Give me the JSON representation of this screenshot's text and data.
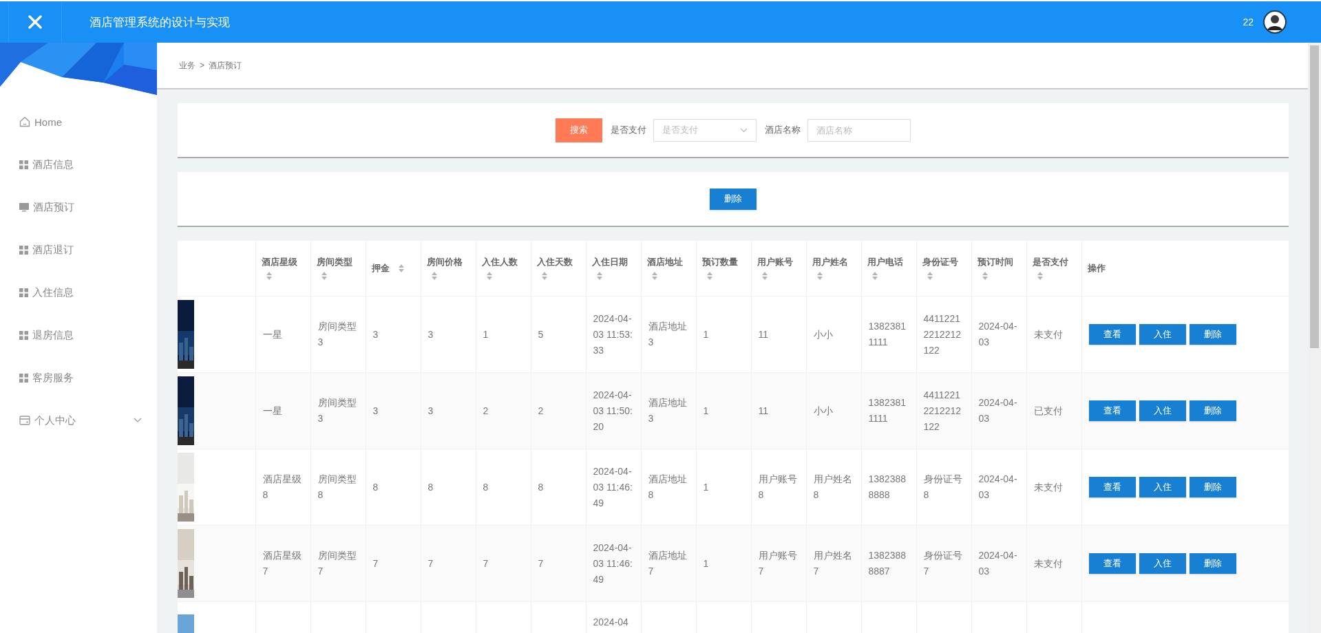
{
  "header": {
    "title": "酒店管理系统的设计与实现",
    "username": "22"
  },
  "sidebar": {
    "items": [
      {
        "label": "Home",
        "kind": "home"
      },
      {
        "label": "酒店信息",
        "kind": "grid"
      },
      {
        "label": "酒店预订",
        "kind": "monitor"
      },
      {
        "label": "酒店退订",
        "kind": "grid"
      },
      {
        "label": "入住信息",
        "kind": "grid"
      },
      {
        "label": "退房信息",
        "kind": "grid"
      },
      {
        "label": "客房服务",
        "kind": "grid"
      },
      {
        "label": "个人中心",
        "kind": "card",
        "expanded": false
      }
    ]
  },
  "breadcrumb": {
    "items": [
      "业务",
      "酒店预订"
    ],
    "separator": ">"
  },
  "search": {
    "button": "搜索",
    "fields": [
      {
        "label": "是否支付",
        "kind": "select",
        "placeholder": "是否支付"
      },
      {
        "label": "酒店名称",
        "kind": "input",
        "placeholder": "酒店名称"
      }
    ]
  },
  "toolbar": {
    "button": "删除"
  },
  "table": {
    "columns": [
      {
        "label": "酒店星级",
        "sortable": true
      },
      {
        "label": "房间类型",
        "sortable": true
      },
      {
        "label": "押金",
        "sortable": true
      },
      {
        "label": "房间价格",
        "sortable": true
      },
      {
        "label": "入住人数",
        "sortable": true
      },
      {
        "label": "入住天数",
        "sortable": true
      },
      {
        "label": "入住日期",
        "sortable": true
      },
      {
        "label": "酒店地址",
        "sortable": true
      },
      {
        "label": "预订数量",
        "sortable": true
      },
      {
        "label": "用户账号",
        "sortable": true
      },
      {
        "label": "用户姓名",
        "sortable": true
      },
      {
        "label": "用户电话",
        "sortable": true
      },
      {
        "label": "身份证号",
        "sortable": true
      },
      {
        "label": "预订时间",
        "sortable": true
      },
      {
        "label": "是否支付",
        "sortable": true
      },
      {
        "label": "操作",
        "sortable": false
      }
    ],
    "rows": [
      {
        "cells": [
          "一星",
          "房间类型3",
          "3",
          "3",
          "1",
          "5",
          "2024-04-03 11:53:33",
          "酒店地址3",
          "1",
          "11",
          "小小",
          "13823811111",
          "44112212212212122",
          "2024-04-03",
          "未支付"
        ],
        "actions": [
          "查看",
          "入住",
          "删除"
        ]
      },
      {
        "cells": [
          "一星",
          "房间类型3",
          "3",
          "3",
          "2",
          "2",
          "2024-04-03 11:50:20",
          "酒店地址3",
          "1",
          "11",
          "小小",
          "13823811111",
          "44112212212212122",
          "2024-04-03",
          "已支付"
        ],
        "actions": [
          "查看",
          "入住",
          "删除"
        ]
      },
      {
        "cells": [
          "酒店星级8",
          "房间类型8",
          "8",
          "8",
          "8",
          "8",
          "2024-04-03 11:46:49",
          "酒店地址8",
          "1",
          "用户账号8",
          "用户姓名8",
          "13823888888",
          "身份证号8",
          "2024-04-03",
          "未支付"
        ],
        "actions": [
          "查看",
          "入住",
          "删除"
        ]
      },
      {
        "cells": [
          "酒店星级7",
          "房间类型7",
          "7",
          "7",
          "7",
          "7",
          "2024-04-03 11:46:49",
          "酒店地址7",
          "1",
          "用户账号7",
          "用户姓名7",
          "13823888887",
          "身份证号7",
          "2024-04-03",
          "未支付"
        ],
        "actions": [
          "查看",
          "入住",
          "删除"
        ]
      },
      {
        "cells": [
          null,
          null,
          null,
          null,
          null,
          null,
          "2024-04",
          null,
          null,
          null,
          null,
          null,
          null,
          null,
          null
        ]
      }
    ]
  }
}
